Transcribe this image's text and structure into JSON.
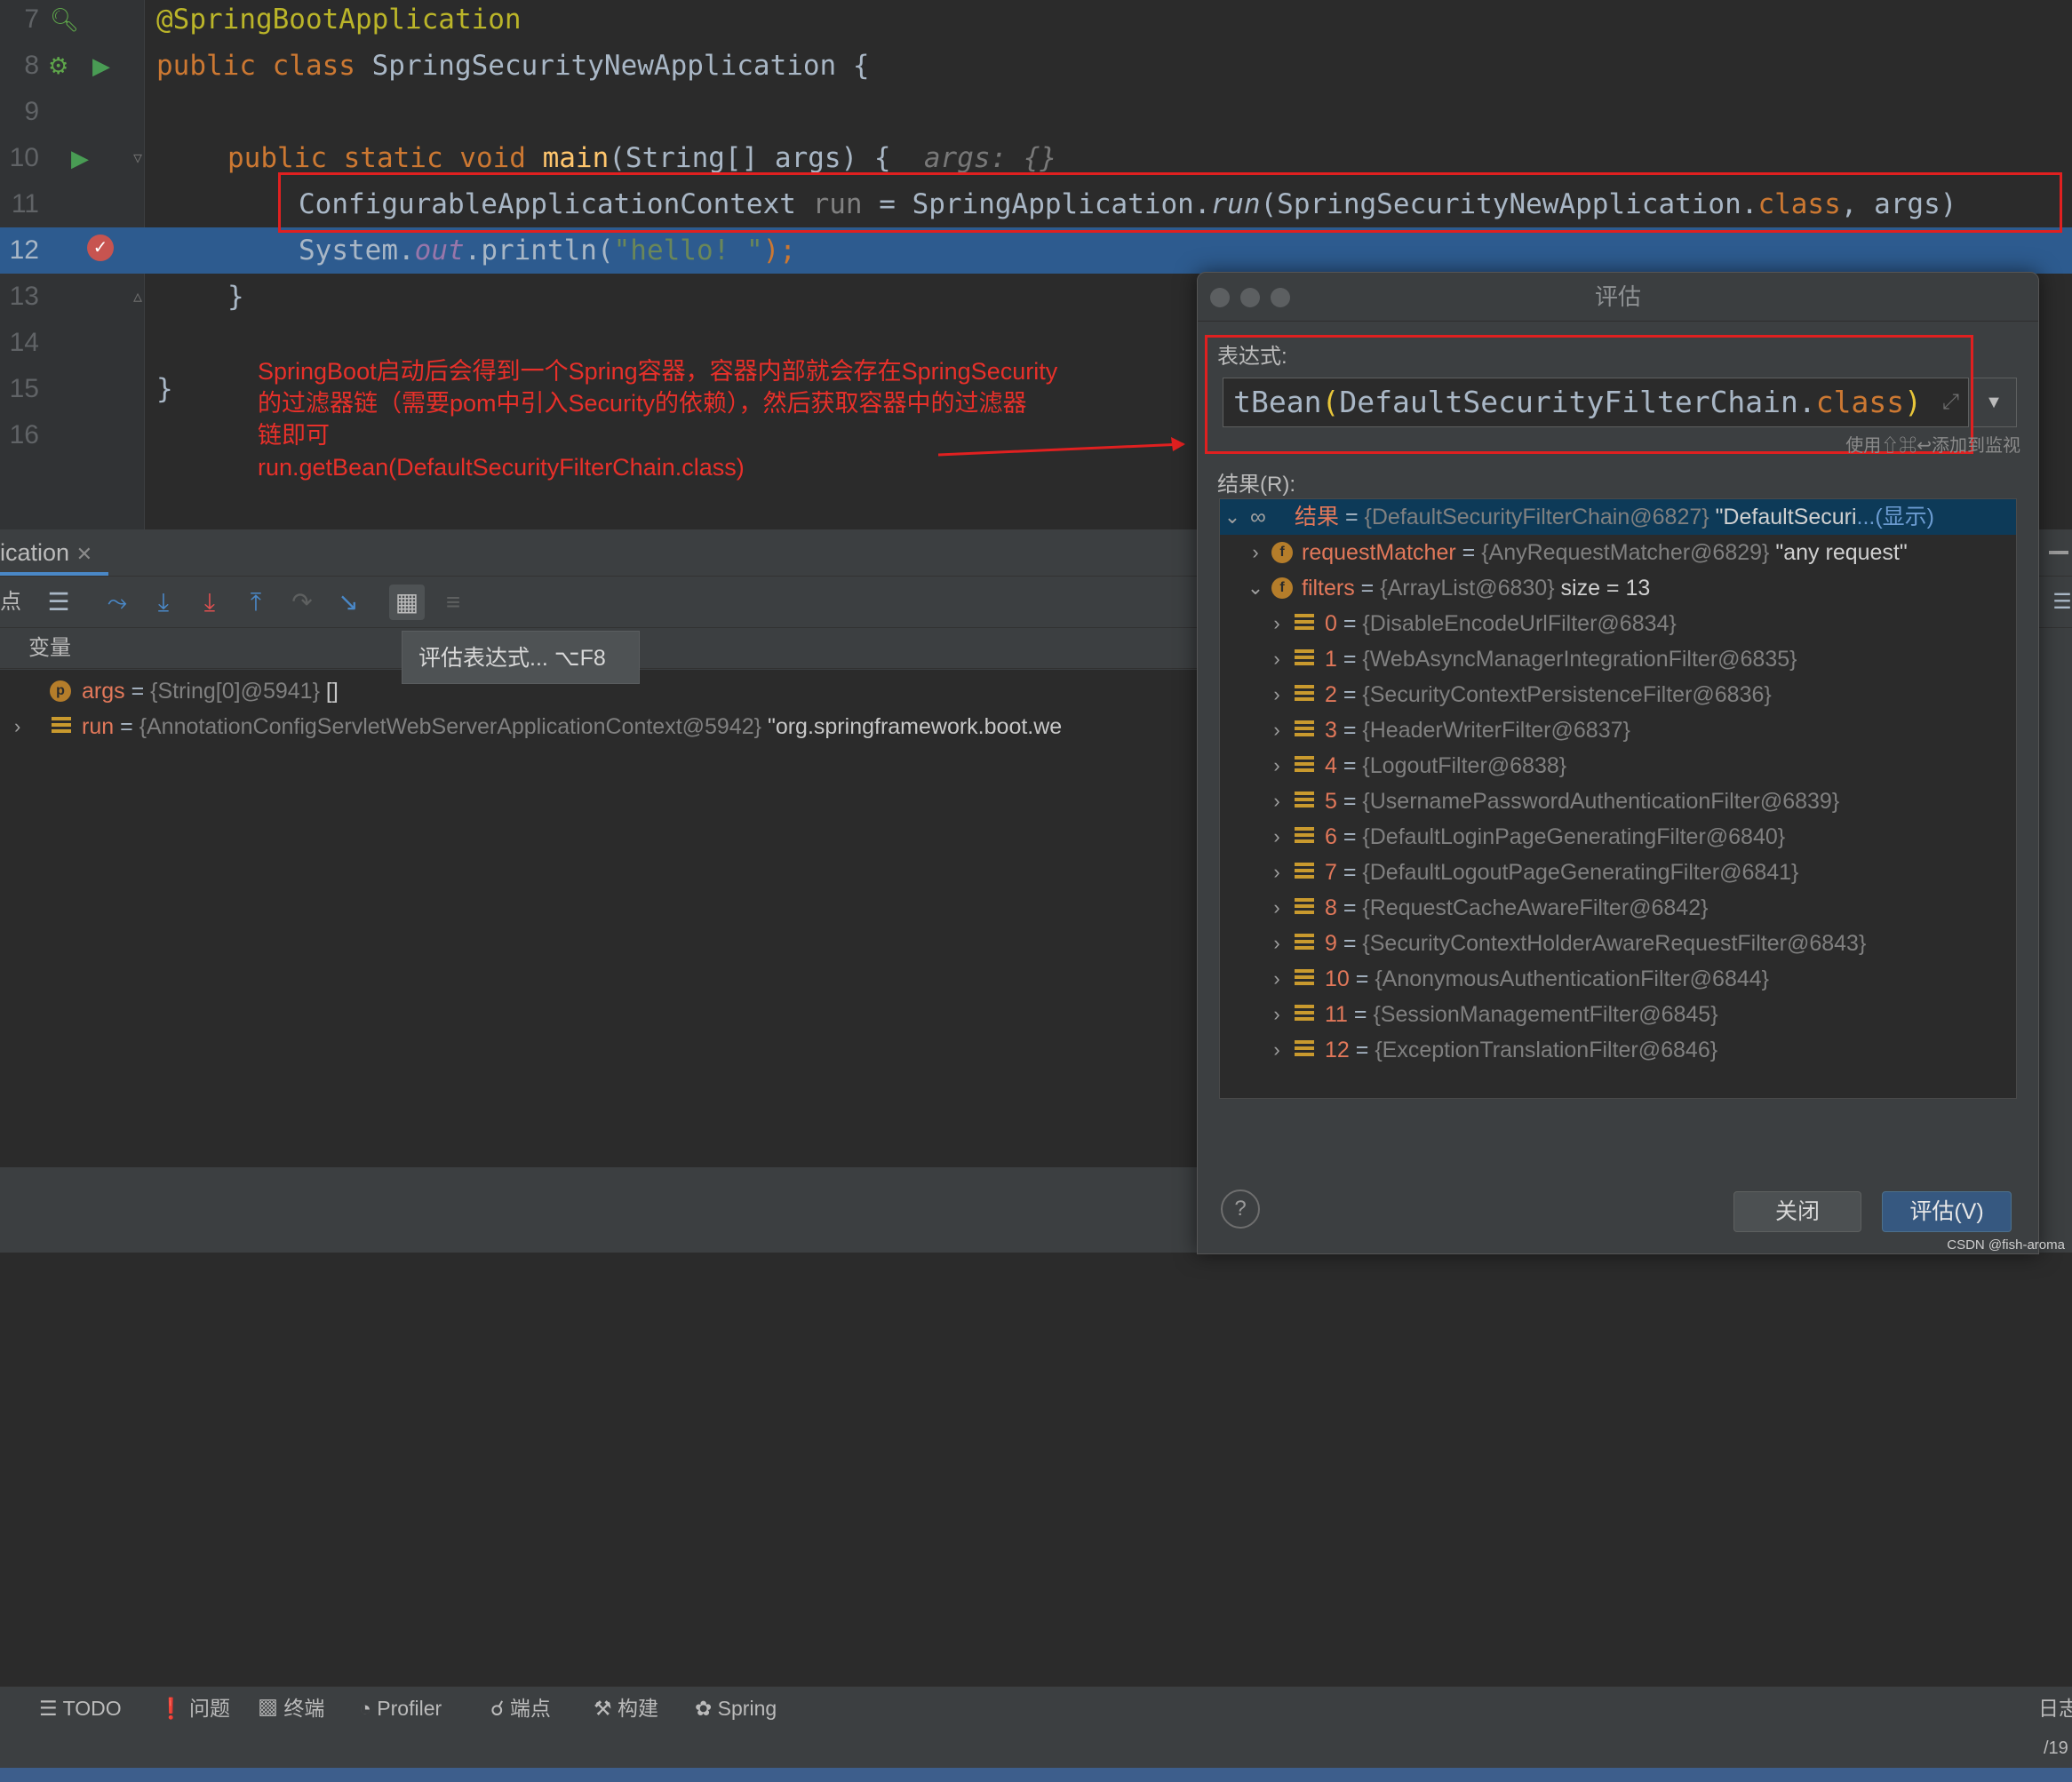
{
  "editor": {
    "lines": [
      {
        "num": "7",
        "code": "@SpringBootApplication"
      },
      {
        "num": "8",
        "kw": "public class ",
        "code": "SpringSecurityNewApplication {"
      },
      {
        "num": "9",
        "code": ""
      },
      {
        "num": "10",
        "kw": "public static void ",
        "fn": "main",
        "code": "(String[] args) {",
        "hint": "args: {}"
      },
      {
        "num": "11",
        "code_a": "ConfigurableApplicationContext ",
        "code_b": "run",
        "code_c": " = SpringApplication.",
        "code_d": "run",
        "code_e": "(SpringSecurityNewApplication.",
        "code_f": "class",
        "code_g": ", args)"
      },
      {
        "num": "12",
        "code_a": "System.",
        "code_b": "out",
        "code_c": ".println(",
        "str": "\"hello! \"",
        "code_d": ");"
      },
      {
        "num": "13",
        "code": "}"
      },
      {
        "num": "14",
        "code": ""
      },
      {
        "num": "15",
        "code": "}"
      },
      {
        "num": "16",
        "code": ""
      }
    ],
    "annotation_note": {
      "line1": "SpringBoot启动后会得到一个Spring容器，容器内部就会存在SpringSecurity",
      "line2": "的过滤器链（需要pom中引入Security的依赖），然后获取容器中的过滤器",
      "line3": "链即可",
      "line4": "run.getBean(DefaultSecurityFilterChain.class)"
    }
  },
  "debug": {
    "tab_label": "ication",
    "toolbar_left_label": "点",
    "vars_header": "变量",
    "variables": [
      {
        "name": "args",
        "value": "{String[0]@5941}",
        "extra": "[]"
      },
      {
        "name": "run",
        "value": "{AnnotationConfigServletWebServerApplicationContext@5942}",
        "extra": "\"org.springframework.boot.we"
      }
    ],
    "tooltip": "评估表达式...  ⌥F8"
  },
  "bottom_bar": {
    "items": [
      "TODO",
      "问题",
      "终端",
      "Profiler",
      "端点",
      "构建",
      "Spring"
    ],
    "right_label": "日志",
    "right_num": "/19"
  },
  "dialog": {
    "title": "评估",
    "expression_label": "表达式:",
    "expression": {
      "a": "tBean",
      "b": "(",
      "c": "DefaultSecurityFilterChain.",
      "d": "class",
      "e": ")"
    },
    "watch_hint": "使用⇧⌘↩添加到监视",
    "result_label": "结果(R):",
    "result_root": {
      "key": "结果",
      "value": "{DefaultSecurityFilterChain@6827}",
      "extra": "\"DefaultSecuri",
      "link": "...(显示)"
    },
    "request_matcher": {
      "key": "requestMatcher",
      "value": "{AnyRequestMatcher@6829}",
      "extra": "\"any request\""
    },
    "filters": {
      "key": "filters",
      "value": "{ArrayList@6830}",
      "extra": "size = 13"
    },
    "filter_items": [
      {
        "idx": "0",
        "value": "{DisableEncodeUrlFilter@6834}"
      },
      {
        "idx": "1",
        "value": "{WebAsyncManagerIntegrationFilter@6835}"
      },
      {
        "idx": "2",
        "value": "{SecurityContextPersistenceFilter@6836}"
      },
      {
        "idx": "3",
        "value": "{HeaderWriterFilter@6837}"
      },
      {
        "idx": "4",
        "value": "{LogoutFilter@6838}"
      },
      {
        "idx": "5",
        "value": "{UsernamePasswordAuthenticationFilter@6839}"
      },
      {
        "idx": "6",
        "value": "{DefaultLoginPageGeneratingFilter@6840}"
      },
      {
        "idx": "7",
        "value": "{DefaultLogoutPageGeneratingFilter@6841}"
      },
      {
        "idx": "8",
        "value": "{RequestCacheAwareFilter@6842}"
      },
      {
        "idx": "9",
        "value": "{SecurityContextHolderAwareRequestFilter@6843}"
      },
      {
        "idx": "10",
        "value": "{AnonymousAuthenticationFilter@6844}"
      },
      {
        "idx": "11",
        "value": "{SessionManagementFilter@6845}"
      },
      {
        "idx": "12",
        "value": "{ExceptionTranslationFilter@6846}"
      }
    ],
    "close_label": "关闭",
    "evaluate_label": "评估(V)",
    "help_label": "?"
  },
  "watermark": "CSDN @fish-aroma",
  "colors": {
    "accent": "#e02020",
    "selection": "#2d5b8f"
  }
}
